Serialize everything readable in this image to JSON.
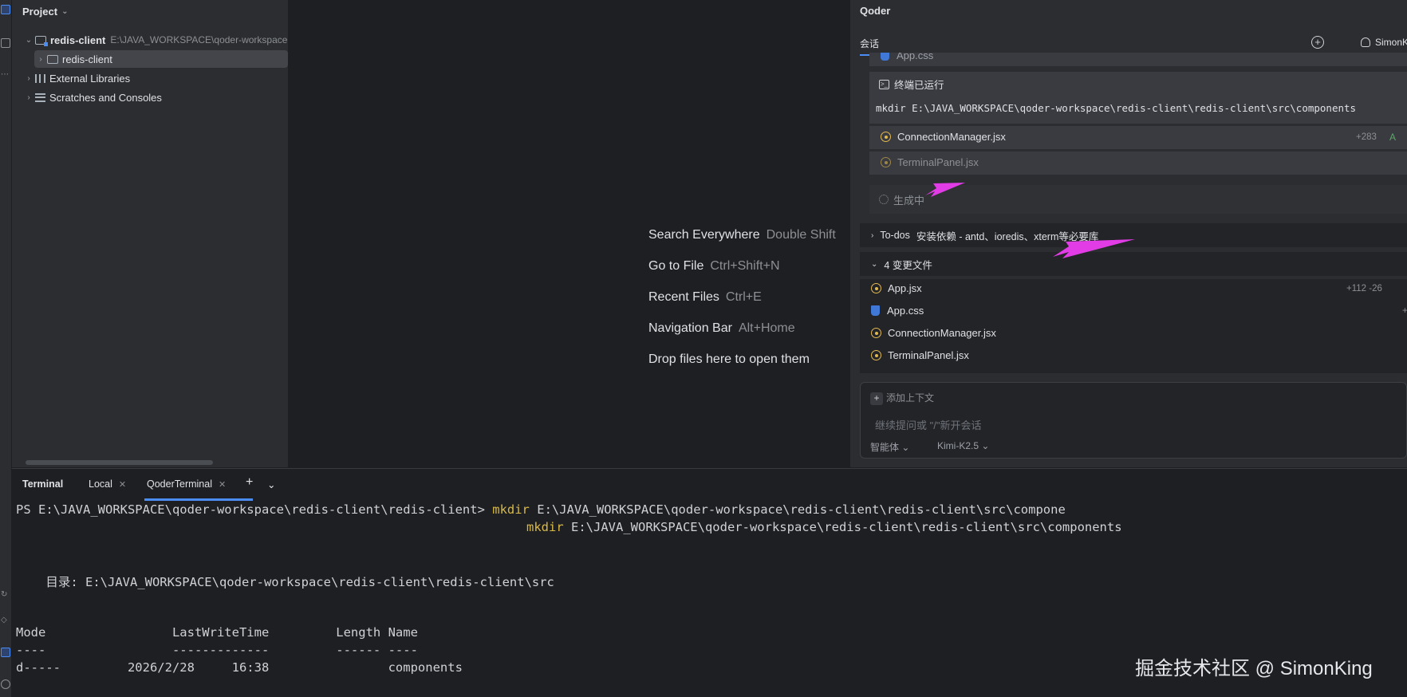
{
  "project_panel": {
    "title": "Project",
    "tree": [
      {
        "label": "redis-client",
        "path": "E:\\JAVA_WORKSPACE\\qoder-workspace"
      },
      {
        "label": "redis-client"
      },
      {
        "label": "External Libraries"
      },
      {
        "label": "Scratches and Consoles"
      }
    ]
  },
  "editor_hints": [
    {
      "action": "Search Everywhere",
      "shortcut": "Double Shift"
    },
    {
      "action": "Go to File",
      "shortcut": "Ctrl+Shift+N"
    },
    {
      "action": "Recent Files",
      "shortcut": "Ctrl+E"
    },
    {
      "action": "Navigation Bar",
      "shortcut": "Alt+Home"
    },
    {
      "action": "Drop files here to open them",
      "shortcut": ""
    }
  ],
  "qoder": {
    "title": "Qoder",
    "tab": "会话",
    "user": "SimonK",
    "partial_top_file": "App.css",
    "terminal_ran_label": "终端已运行",
    "command": "mkdir E:\\JAVA_WORKSPACE\\qoder-workspace\\redis-client\\redis-client\\src\\components",
    "generated_files": [
      {
        "name": "ConnectionManager.jsx",
        "diff": "+283",
        "status": "A"
      },
      {
        "name": "TerminalPanel.jsx"
      }
    ],
    "generating_label": "生成中",
    "todos_label": "To-dos",
    "todos_text": "安装依赖 - antd、ioredis、xterm等必要库",
    "changed_files_label": "4 变更文件",
    "changed_files": [
      {
        "name": "App.jsx",
        "diff": "+112 -26",
        "icon": "react-icon"
      },
      {
        "name": "App.css",
        "diff": "+",
        "icon": "css-icon"
      },
      {
        "name": "ConnectionManager.jsx",
        "diff": "",
        "icon": "react-icon"
      },
      {
        "name": "TerminalPanel.jsx",
        "diff": "",
        "icon": "react-icon"
      }
    ],
    "add_context": "添加上下文",
    "input_placeholder": "继续提问或 \"/\"新开会话",
    "mode_select": "智能体",
    "model_select": "Kimi-K2.5"
  },
  "terminal": {
    "tabs": [
      "Terminal",
      "Local",
      "QoderTerminal"
    ],
    "lines": {
      "prompt": "PS E:\\JAVA_WORKSPACE\\qoder-workspace\\redis-client\\redis-client> ",
      "cmd1_kw": "mkdir",
      "cmd1_arg": " E:\\JAVA_WORKSPACE\\qoder-workspace\\redis-client\\redis-client\\src\\compone",
      "cmd2_kw": "mkdir",
      "cmd2_arg": " E:\\JAVA_WORKSPACE\\qoder-workspace\\redis-client\\redis-client\\src\\components",
      "dir_line": "    目录: E:\\JAVA_WORKSPACE\\qoder-workspace\\redis-client\\redis-client\\src",
      "header": "Mode                 LastWriteTime         Length Name",
      "sep": "----                 -------------         ------ ----",
      "row": "d-----         2026/2/28     16:38                components"
    }
  },
  "watermark": "掘金技术社区 @ SimonKing",
  "colors": {
    "accent": "#4c8cf5",
    "annotation_arrow": "#e23ce6",
    "keyword": "#d8b948"
  }
}
